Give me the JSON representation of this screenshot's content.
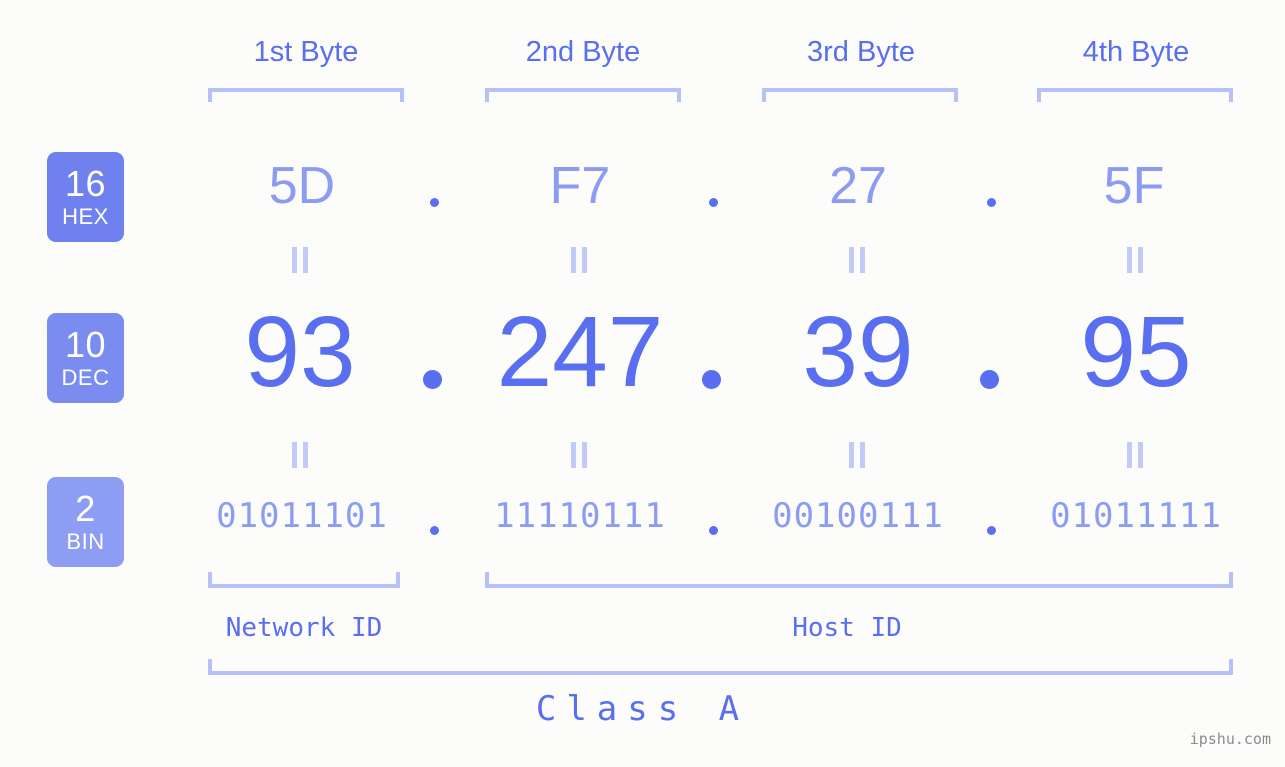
{
  "site": {
    "watermark": "ipshu.com"
  },
  "header": {
    "bytes": [
      {
        "label": "1st Byte"
      },
      {
        "label": "2nd Byte"
      },
      {
        "label": "3rd Byte"
      },
      {
        "label": "4th Byte"
      }
    ]
  },
  "bases": [
    {
      "number": "16",
      "abbr": "HEX",
      "color": "#6f81ef"
    },
    {
      "number": "10",
      "abbr": "DEC",
      "color": "#7b8cf1"
    },
    {
      "number": "2",
      "abbr": "BIN",
      "color": "#8e9df4"
    }
  ],
  "rows": {
    "hex": {
      "values": [
        "5D",
        "F7",
        "27",
        "5F"
      ],
      "separator": "."
    },
    "dec": {
      "values": [
        "93",
        "247",
        "39",
        "95"
      ],
      "separator": "."
    },
    "bin": {
      "values": [
        "01011101",
        "11110111",
        "00100111",
        "01011111"
      ],
      "separator": "."
    }
  },
  "equals_marker": "=",
  "segments": {
    "network": {
      "label": "Network ID"
    },
    "host": {
      "label": "Host ID"
    },
    "class": {
      "label": "Class A"
    }
  },
  "ip_address": "93.247.39.95",
  "colors": {
    "background": "#fcfdfa",
    "accent_strong": "#5a6ef0",
    "accent_light": "#8c9bf3",
    "bracket": "#b7c0f7",
    "equals": "#c2caf9",
    "watermark": "#8b8b8b"
  }
}
